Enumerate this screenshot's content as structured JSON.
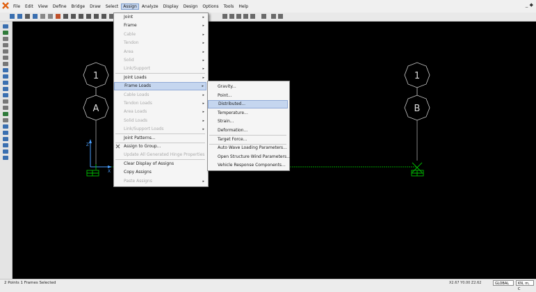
{
  "menubar": {
    "items": [
      "File",
      "Edit",
      "View",
      "Define",
      "Bridge",
      "Draw",
      "Select",
      "Assign",
      "Analyze",
      "Display",
      "Design",
      "Options",
      "Tools",
      "Help"
    ],
    "active": "Assign",
    "window_controls": "_ ◆"
  },
  "assign_menu": {
    "items": [
      {
        "label": "Joint",
        "disabled": false,
        "submenu": true
      },
      {
        "label": "Frame",
        "disabled": false,
        "submenu": true
      },
      {
        "label": "Cable",
        "disabled": true,
        "submenu": true
      },
      {
        "label": "Tendon",
        "disabled": true,
        "submenu": true
      },
      {
        "label": "Area",
        "disabled": true,
        "submenu": true
      },
      {
        "label": "Solid",
        "disabled": true,
        "submenu": true
      },
      {
        "label": "Link/Support",
        "disabled": true,
        "submenu": true
      },
      {
        "label": "Joint Loads",
        "disabled": false,
        "submenu": true
      },
      {
        "label": "Frame Loads",
        "disabled": false,
        "submenu": true,
        "highlighted": true
      },
      {
        "label": "Cable Loads",
        "disabled": true,
        "submenu": true
      },
      {
        "label": "Tendon Loads",
        "disabled": true,
        "submenu": true
      },
      {
        "label": "Area Loads",
        "disabled": true,
        "submenu": true
      },
      {
        "label": "Solid Loads",
        "disabled": true,
        "submenu": true
      },
      {
        "label": "Link/Support Loads",
        "disabled": true,
        "submenu": true
      },
      {
        "label": "Joint Patterns...",
        "disabled": false,
        "submenu": false
      },
      {
        "label": "Assign to Group...",
        "disabled": false,
        "submenu": false,
        "icon": "group-icon"
      },
      {
        "label": "Update All Generated Hinge Properties",
        "disabled": true,
        "submenu": false
      },
      {
        "label": "Clear Display of Assigns",
        "disabled": false,
        "submenu": false
      },
      {
        "label": "Copy Assigns",
        "disabled": false,
        "submenu": false
      },
      {
        "label": "Paste Assigns",
        "disabled": true,
        "submenu": true
      }
    ]
  },
  "frame_loads_menu": {
    "items": [
      {
        "label": "Gravity..."
      },
      {
        "label": "Point..."
      },
      {
        "label": "Distributed...",
        "highlighted": true
      },
      {
        "label": "Temperature..."
      },
      {
        "label": "Strain..."
      },
      {
        "label": "Deformation..."
      },
      {
        "label": "Target Force..."
      },
      {
        "label": "Auto Wave Loading Parameters..."
      },
      {
        "label": "Open Structure Wind Parameters..."
      },
      {
        "label": "Vehicle Response Components..."
      }
    ]
  },
  "canvas": {
    "grid_bubbles": [
      {
        "label": "1"
      },
      {
        "label": "A"
      },
      {
        "label": "1"
      },
      {
        "label": "B"
      }
    ],
    "axis_labels": {
      "z": "Z",
      "x": "X"
    }
  },
  "status": {
    "text": "2 Points 1 Frames Selected",
    "coords": "X2.67  Y0.00  Z2.62",
    "coord_system": "GLOBAL",
    "units": "KN, m, C"
  },
  "colors": {
    "canvas_bg": "#000000",
    "grid_line": "#bdbdbd",
    "frame_line": "#00a000",
    "support": "#00c000",
    "menu_highlight": "#c5d6ef"
  }
}
